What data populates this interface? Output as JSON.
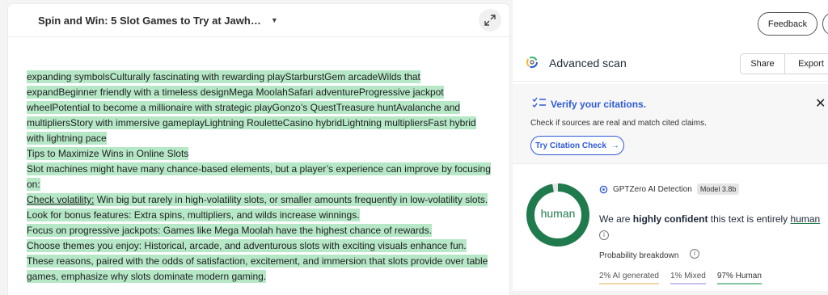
{
  "document": {
    "title": "Spin and Win: 5 Slot Games to Try at Jawh…",
    "paragraphs": [
      {
        "text": "expanding symbolsCulturally fascinating with rewarding playStarburstGem arcadeWilds that expandBeginner friendly with a timeless designMega MoolahSafari adventureProgressive jackpot wheelPotential to become a millionaire with strategic playGonzo’s QuestTreasure huntAvalanche and multipliersStory with immersive gameplayLightning RouletteCasino hybridLightning multipliersFast hybrid with lightning pace"
      },
      {
        "text": "Tips to Maximize Wins in Online Slots"
      },
      {
        "text": " Slot machines might have many chance-based elements, but a player’s experience can improve by focusing on:"
      },
      {
        "lead": "Check volatility:",
        "text": " Win big but rarely in high-volatility slots, or smaller amounts frequently in low-volatility slots."
      },
      {
        "text": "Look for bonus features: Extra spins, multipliers, and wilds increase winnings."
      },
      {
        "text": "Focus on progressive jackpots: Games like Mega Moolah have the highest chance of rewards."
      },
      {
        "text": "Choose themes you enjoy: Historical, arcade, and adventurous slots with exciting visuals enhance fun."
      },
      {
        "text": "These reasons, paired with the odds of satisfaction, excitement, and immersion that slots provide over table games, emphasize why slots dominate modern gaming."
      }
    ]
  },
  "header": {
    "feedback_label": "Feedback"
  },
  "scan": {
    "title": "Advanced scan",
    "share_label": "Share",
    "export_label": "Export"
  },
  "citation": {
    "title": "Verify your citations.",
    "description": "Check if sources are real and match cited claims.",
    "button_label": "Try Citation Check"
  },
  "detection": {
    "donut_label": "human",
    "brand": "GPTZero AI Detection",
    "model_badge": "Model 3.8b",
    "confidence_prefix": "We are ",
    "confidence_strong": "highly confident",
    "confidence_mid": " this text is entirely ",
    "confidence_result": "human",
    "breakdown_title": "Probability breakdown",
    "breakdown": {
      "ai": "2% AI generated",
      "mixed": "1% Mixed",
      "human": "97% Human"
    },
    "human_fraction": 0.97,
    "colors": {
      "human": "#1f7a4d",
      "ai": "#f0d7a8",
      "mixed": "#c9c1ec",
      "citation_accent": "#2f5ad7",
      "highlight": "#b6e8c8"
    }
  }
}
